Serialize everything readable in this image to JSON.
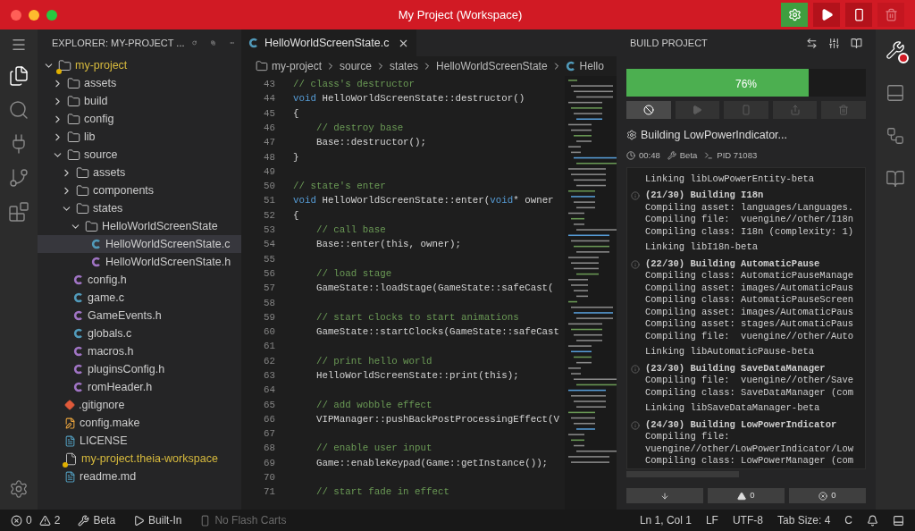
{
  "window": {
    "title": "My Project (Workspace)",
    "actions": [
      {
        "kind": "settings",
        "disabled": false
      },
      {
        "kind": "run",
        "disabled": false
      },
      {
        "kind": "flash",
        "disabled": false
      },
      {
        "kind": "clean",
        "disabled": true
      }
    ]
  },
  "activity_bar": [
    {
      "kind": "explorer",
      "selected": true
    },
    {
      "kind": "search",
      "selected": false
    },
    {
      "kind": "plugins",
      "selected": false
    },
    {
      "kind": "source-control",
      "selected": false
    },
    {
      "kind": "extensions",
      "selected": false
    }
  ],
  "explorer": {
    "title": "EXPLORER: MY-PROJECT ...",
    "tree": [
      {
        "label": "my-project",
        "kind": "folder",
        "expanded": true,
        "warning": true,
        "selected": false,
        "children": [
          {
            "label": "assets",
            "kind": "folder",
            "expanded": false,
            "warning": false,
            "selected": false
          },
          {
            "label": "build",
            "kind": "folder",
            "expanded": false,
            "warning": false,
            "selected": false
          },
          {
            "label": "config",
            "kind": "folder",
            "expanded": false,
            "warning": false,
            "selected": false
          },
          {
            "label": "lib",
            "kind": "folder",
            "expanded": false,
            "warning": false,
            "selected": false
          },
          {
            "label": "source",
            "kind": "folder",
            "expanded": true,
            "warning": false,
            "selected": false,
            "children": [
              {
                "label": "assets",
                "kind": "folder",
                "expanded": false,
                "warning": false,
                "selected": false
              },
              {
                "label": "components",
                "kind": "folder",
                "expanded": false,
                "warning": false,
                "selected": false
              },
              {
                "label": "states",
                "kind": "folder",
                "expanded": true,
                "warning": false,
                "selected": false,
                "children": [
                  {
                    "label": "HelloWorldScreenState",
                    "kind": "folder",
                    "expanded": true,
                    "warning": false,
                    "selected": false,
                    "children": [
                      {
                        "label": "HelloWorldScreenState.c",
                        "kind": "c",
                        "warning": false,
                        "selected": true
                      },
                      {
                        "label": "HelloWorldScreenState.h",
                        "kind": "h",
                        "warning": false,
                        "selected": false
                      }
                    ]
                  }
                ]
              },
              {
                "label": "config.h",
                "kind": "h",
                "warning": false,
                "selected": false
              },
              {
                "label": "game.c",
                "kind": "c",
                "warning": false,
                "selected": false
              },
              {
                "label": "GameEvents.h",
                "kind": "h",
                "warning": false,
                "selected": false
              },
              {
                "label": "globals.c",
                "kind": "c",
                "warning": false,
                "selected": false
              },
              {
                "label": "macros.h",
                "kind": "h",
                "warning": false,
                "selected": false
              },
              {
                "label": "pluginsConfig.h",
                "kind": "h",
                "warning": false,
                "selected": false
              },
              {
                "label": "romHeader.h",
                "kind": "h",
                "warning": false,
                "selected": false
              }
            ]
          },
          {
            "label": ".gitignore",
            "kind": "git",
            "warning": false,
            "selected": false
          },
          {
            "label": "config.make",
            "kind": "make",
            "warning": false,
            "selected": false
          },
          {
            "label": "LICENSE",
            "kind": "text",
            "warning": false,
            "selected": false
          },
          {
            "label": "my-project.theia-workspace",
            "kind": "workspace",
            "warning": true,
            "selected": false
          },
          {
            "label": "readme.md",
            "kind": "text",
            "warning": false,
            "selected": false
          }
        ]
      }
    ]
  },
  "editor": {
    "tabs": [
      {
        "label": "HelloWorldScreenState.c",
        "selected": true
      }
    ],
    "breadcrumb": [
      "my-project",
      "source",
      "states",
      "HelloWorldScreenState",
      "Hello"
    ],
    "lines": [
      {
        "n": "43",
        "tokens": [
          {
            "kind": "comment",
            "text": "// class's destructor"
          }
        ]
      },
      {
        "n": "44",
        "tokens": [
          {
            "kind": "keyword",
            "text": "void"
          },
          {
            "kind": "plain",
            "text": " HelloWorldScreenState::destructor()"
          }
        ]
      },
      {
        "n": "45",
        "tokens": [
          {
            "kind": "plain",
            "text": "{"
          }
        ]
      },
      {
        "n": "46",
        "tokens": [
          {
            "kind": "comment",
            "text": "    // destroy base"
          }
        ]
      },
      {
        "n": "47",
        "tokens": [
          {
            "kind": "plain",
            "text": "    Base::destructor();"
          }
        ]
      },
      {
        "n": "48",
        "tokens": [
          {
            "kind": "plain",
            "text": "}"
          }
        ]
      },
      {
        "n": "49"
      },
      {
        "n": "50",
        "tokens": [
          {
            "kind": "comment",
            "text": "// state's enter"
          }
        ]
      },
      {
        "n": "51",
        "tokens": [
          {
            "kind": "keyword",
            "text": "void"
          },
          {
            "kind": "plain",
            "text": " HelloWorldScreenState::enter("
          },
          {
            "kind": "keyword",
            "text": "void"
          },
          {
            "kind": "plain",
            "text": "* owner"
          }
        ]
      },
      {
        "n": "52",
        "tokens": [
          {
            "kind": "plain",
            "text": "{"
          }
        ]
      },
      {
        "n": "53",
        "tokens": [
          {
            "kind": "comment",
            "text": "    // call base"
          }
        ]
      },
      {
        "n": "54",
        "tokens": [
          {
            "kind": "plain",
            "text": "    Base::enter(this, owner);"
          }
        ]
      },
      {
        "n": "55"
      },
      {
        "n": "56",
        "tokens": [
          {
            "kind": "comment",
            "text": "    // load stage"
          }
        ]
      },
      {
        "n": "57",
        "tokens": [
          {
            "kind": "plain",
            "text": "    GameState::loadStage(GameState::safeCast("
          }
        ]
      },
      {
        "n": "58"
      },
      {
        "n": "59",
        "tokens": [
          {
            "kind": "comment",
            "text": "    // start clocks to start animations"
          }
        ]
      },
      {
        "n": "60",
        "tokens": [
          {
            "kind": "plain",
            "text": "    GameState::startClocks(GameState::safeCast"
          }
        ]
      },
      {
        "n": "61"
      },
      {
        "n": "62",
        "tokens": [
          {
            "kind": "comment",
            "text": "    // print hello world"
          }
        ]
      },
      {
        "n": "63",
        "tokens": [
          {
            "kind": "plain",
            "text": "    HelloWorldScreenState::print(this);"
          }
        ]
      },
      {
        "n": "64"
      },
      {
        "n": "65",
        "tokens": [
          {
            "kind": "comment",
            "text": "    // add wobble effect"
          }
        ]
      },
      {
        "n": "66",
        "tokens": [
          {
            "kind": "plain",
            "text": "    VIPManager::pushBackPostProcessingEffect(V"
          }
        ]
      },
      {
        "n": "67"
      },
      {
        "n": "68",
        "tokens": [
          {
            "kind": "comment",
            "text": "    // enable user input"
          }
        ]
      },
      {
        "n": "69",
        "tokens": [
          {
            "kind": "plain",
            "text": "    Game::enableKeypad(Game::getInstance());"
          }
        ]
      },
      {
        "n": "70"
      },
      {
        "n": "71",
        "tokens": [
          {
            "kind": "comment",
            "text": "    // start fade in effect"
          }
        ]
      }
    ]
  },
  "build": {
    "title": "BUILD PROJECT",
    "progress": {
      "level": 0.76,
      "label": "76%"
    },
    "controls": [
      {
        "kind": "abort",
        "disabled": false
      },
      {
        "kind": "run",
        "disabled": true
      },
      {
        "kind": "flash",
        "disabled": true
      },
      {
        "kind": "export",
        "disabled": true
      },
      {
        "kind": "clean",
        "disabled": true
      }
    ],
    "status": "Building LowPowerIndicator...",
    "elapsed": "00:48",
    "mode": "Beta",
    "pid": "PID 71083",
    "log": [
      {
        "kind": "line",
        "text": "Linking libLowPowerEntity-beta"
      },
      {
        "kind": "step",
        "text": "(21/30) Building I18n"
      },
      {
        "kind": "detail",
        "text": "Compiling asset: languages/Languages."
      },
      {
        "kind": "detail",
        "text": "Compiling file:  vuengine//other/I18n"
      },
      {
        "kind": "detail",
        "text": "Compiling class: I18n (complexity: 1)"
      },
      {
        "kind": "line",
        "text": "Linking libI18n-beta"
      },
      {
        "kind": "step",
        "text": "(22/30) Building AutomaticPause"
      },
      {
        "kind": "detail",
        "text": "Compiling class: AutomaticPauseManage"
      },
      {
        "kind": "detail",
        "text": "Compiling asset: images/AutomaticPaus"
      },
      {
        "kind": "detail",
        "text": "Compiling class: AutomaticPauseScreen"
      },
      {
        "kind": "detail",
        "text": "Compiling asset: images/AutomaticPaus"
      },
      {
        "kind": "detail",
        "text": "Compiling asset: stages/AutomaticPaus"
      },
      {
        "kind": "detail",
        "text": "Compiling file:  vuengine//other/Auto"
      },
      {
        "kind": "line",
        "text": "Linking libAutomaticPause-beta"
      },
      {
        "kind": "step",
        "text": "(23/30) Building SaveDataManager"
      },
      {
        "kind": "detail",
        "text": "Compiling file:  vuengine//other/Save"
      },
      {
        "kind": "detail",
        "text": "Compiling class: SaveDataManager (com"
      },
      {
        "kind": "line",
        "text": "Linking libSaveDataManager-beta"
      },
      {
        "kind": "step",
        "text": "(24/30) Building LowPowerIndicator"
      },
      {
        "kind": "detail",
        "text": "Compiling file:"
      },
      {
        "kind": "detail",
        "text": "vuengine//other/LowPowerIndicator/Low"
      },
      {
        "kind": "detail",
        "text": "Compiling class: LowPowerManager (com"
      }
    ],
    "filters": [
      {
        "kind": "scroll-lock",
        "selected": false
      },
      {
        "kind": "warnings",
        "selected": false,
        "count": "0"
      },
      {
        "kind": "errors",
        "selected": false,
        "count": "0"
      }
    ]
  },
  "right_bar": [
    {
      "kind": "build",
      "selected": true
    },
    {
      "kind": "panel",
      "selected": false
    },
    {
      "kind": "diagram",
      "selected": false
    },
    {
      "kind": "docs",
      "selected": false
    }
  ],
  "status_bar": {
    "left": [
      {
        "kind": "problems",
        "errors": "0",
        "warnings": "2"
      },
      {
        "kind": "build-mode",
        "text": "Beta",
        "disabled": false
      },
      {
        "kind": "emulator",
        "text": "Built-In",
        "disabled": false
      },
      {
        "kind": "flash-cart",
        "text": "No Flash Carts",
        "disabled": true
      }
    ],
    "right": [
      "Ln 1, Col 1",
      "LF",
      "UTF-8",
      "Tab Size: 4",
      "C"
    ]
  }
}
